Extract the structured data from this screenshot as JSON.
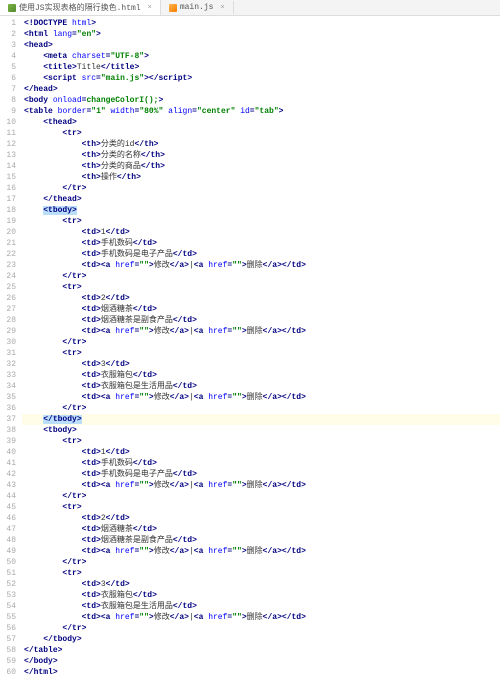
{
  "tabs": [
    {
      "label": "使用JS实现表格的隔行换色.html",
      "active": true,
      "icon": "html"
    },
    {
      "label": "main.js",
      "active": false,
      "icon": "js"
    }
  ],
  "highlight_line": 37,
  "selection_lines": [
    18,
    37
  ],
  "code_lines": [
    {
      "n": 1,
      "indent": 0,
      "raw": "<!DOCTYPE html>"
    },
    {
      "n": 2,
      "indent": 0,
      "raw": "<html lang=\"en\">"
    },
    {
      "n": 3,
      "indent": 0,
      "raw": "<head>"
    },
    {
      "n": 4,
      "indent": 1,
      "raw": "<meta charset=\"UTF-8\">"
    },
    {
      "n": 5,
      "indent": 1,
      "raw": "<title>Title</title>"
    },
    {
      "n": 6,
      "indent": 1,
      "raw": "<script src=\"main.js\"></script>"
    },
    {
      "n": 7,
      "indent": 0,
      "raw": "</head>"
    },
    {
      "n": 8,
      "indent": 0,
      "raw": "<body onload=changeColorI();>"
    },
    {
      "n": 9,
      "indent": 0,
      "raw": "<table border=\"1\" width=\"80%\" align=\"center\" id=\"tab\">"
    },
    {
      "n": 10,
      "indent": 1,
      "raw": "<thead>"
    },
    {
      "n": 11,
      "indent": 2,
      "raw": "<tr>"
    },
    {
      "n": 12,
      "indent": 3,
      "raw": "<th>分类的id</th>"
    },
    {
      "n": 13,
      "indent": 3,
      "raw": "<th>分类的名称</th>"
    },
    {
      "n": 14,
      "indent": 3,
      "raw": "<th>分类的商品</th>"
    },
    {
      "n": 15,
      "indent": 3,
      "raw": "<th>操作</th>"
    },
    {
      "n": 16,
      "indent": 2,
      "raw": "</tr>"
    },
    {
      "n": 17,
      "indent": 1,
      "raw": "</thead>"
    },
    {
      "n": 18,
      "indent": 1,
      "raw": "<tbody>"
    },
    {
      "n": 19,
      "indent": 2,
      "raw": "<tr>"
    },
    {
      "n": 20,
      "indent": 3,
      "raw": "<td>1</td>"
    },
    {
      "n": 21,
      "indent": 3,
      "raw": "<td>手机数码</td>"
    },
    {
      "n": 22,
      "indent": 3,
      "raw": "<td>手机数码是电子产品</td>"
    },
    {
      "n": 23,
      "indent": 3,
      "raw": "<td><a href=\"\">修改</a>|<a href=\"\">删除</a></td>"
    },
    {
      "n": 24,
      "indent": 2,
      "raw": "</tr>"
    },
    {
      "n": 25,
      "indent": 2,
      "raw": "<tr>"
    },
    {
      "n": 26,
      "indent": 3,
      "raw": "<td>2</td>"
    },
    {
      "n": 27,
      "indent": 3,
      "raw": "<td>烟酒糖茶</td>"
    },
    {
      "n": 28,
      "indent": 3,
      "raw": "<td>烟酒糖茶是副食产品</td>"
    },
    {
      "n": 29,
      "indent": 3,
      "raw": "<td><a href=\"\">修改</a>|<a href=\"\">删除</a></td>"
    },
    {
      "n": 30,
      "indent": 2,
      "raw": "</tr>"
    },
    {
      "n": 31,
      "indent": 2,
      "raw": "<tr>"
    },
    {
      "n": 32,
      "indent": 3,
      "raw": "<td>3</td>"
    },
    {
      "n": 33,
      "indent": 3,
      "raw": "<td>衣服箱包</td>"
    },
    {
      "n": 34,
      "indent": 3,
      "raw": "<td>衣服箱包是生活用品</td>"
    },
    {
      "n": 35,
      "indent": 3,
      "raw": "<td><a href=\"\">修改</a>|<a href=\"\">删除</a></td>"
    },
    {
      "n": 36,
      "indent": 2,
      "raw": "</tr>"
    },
    {
      "n": 37,
      "indent": 1,
      "raw": "</tbody>"
    },
    {
      "n": 38,
      "indent": 1,
      "raw": "<tbody>"
    },
    {
      "n": 39,
      "indent": 2,
      "raw": "<tr>"
    },
    {
      "n": 40,
      "indent": 3,
      "raw": "<td>1</td>"
    },
    {
      "n": 41,
      "indent": 3,
      "raw": "<td>手机数码</td>"
    },
    {
      "n": 42,
      "indent": 3,
      "raw": "<td>手机数码是电子产品</td>"
    },
    {
      "n": 43,
      "indent": 3,
      "raw": "<td><a href=\"\">修改</a>|<a href=\"\">删除</a></td>"
    },
    {
      "n": 44,
      "indent": 2,
      "raw": "</tr>"
    },
    {
      "n": 45,
      "indent": 2,
      "raw": "<tr>"
    },
    {
      "n": 46,
      "indent": 3,
      "raw": "<td>2</td>"
    },
    {
      "n": 47,
      "indent": 3,
      "raw": "<td>烟酒糖茶</td>"
    },
    {
      "n": 48,
      "indent": 3,
      "raw": "<td>烟酒糖茶是副食产品</td>"
    },
    {
      "n": 49,
      "indent": 3,
      "raw": "<td><a href=\"\">修改</a>|<a href=\"\">删除</a></td>"
    },
    {
      "n": 50,
      "indent": 2,
      "raw": "</tr>"
    },
    {
      "n": 51,
      "indent": 2,
      "raw": "<tr>"
    },
    {
      "n": 52,
      "indent": 3,
      "raw": "<td>3</td>"
    },
    {
      "n": 53,
      "indent": 3,
      "raw": "<td>衣服箱包</td>"
    },
    {
      "n": 54,
      "indent": 3,
      "raw": "<td>衣服箱包是生活用品</td>"
    },
    {
      "n": 55,
      "indent": 3,
      "raw": "<td><a href=\"\">修改</a>|<a href=\"\">删除</a></td>"
    },
    {
      "n": 56,
      "indent": 2,
      "raw": "</tr>"
    },
    {
      "n": 57,
      "indent": 1,
      "raw": "</tbody>"
    },
    {
      "n": 58,
      "indent": 0,
      "raw": "</table>"
    },
    {
      "n": 59,
      "indent": 0,
      "raw": "</body>"
    },
    {
      "n": 60,
      "indent": 0,
      "raw": "</html>"
    }
  ]
}
